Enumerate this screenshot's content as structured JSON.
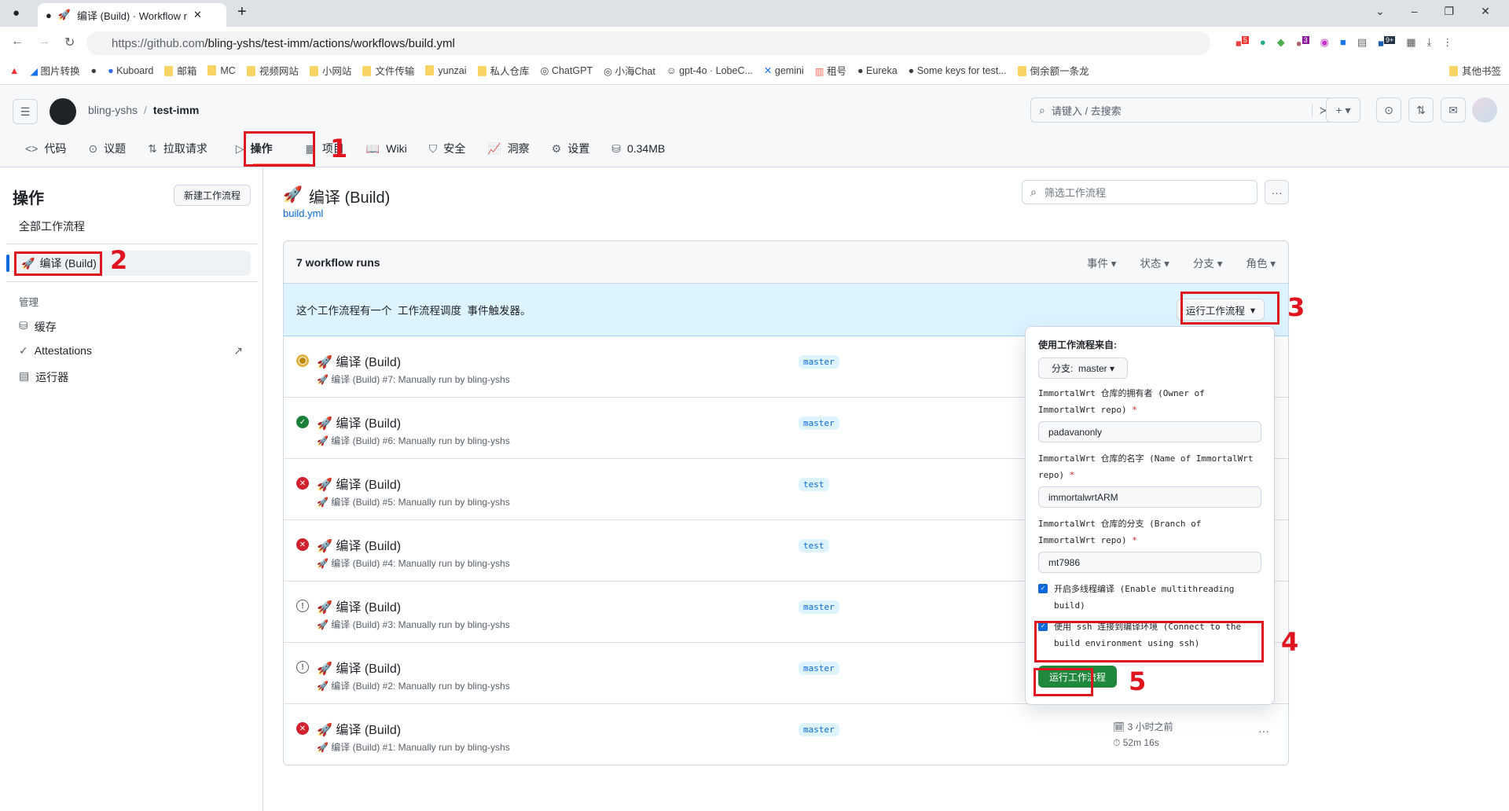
{
  "browser": {
    "tab_title": "编译 (Build) · Workflow run",
    "url_host": "https://github.com",
    "url_path": "/bling-yshs/test-imm/actions/workflows/build.yml",
    "bookmarks": [
      "图片转换",
      "",
      "Kuboard",
      "邮箱",
      "MC",
      "视频网站",
      "小网站",
      "文件传输",
      "yunzai",
      "私人仓库",
      "ChatGPT",
      "小海Chat",
      "gpt-4o · LobeC...",
      "gemini",
      "租号",
      "Eureka",
      "Some keys for test...",
      "倒余额一条龙"
    ],
    "other_bookmarks": "其他书签",
    "ext_badges": [
      "5",
      "3",
      "9+"
    ]
  },
  "header": {
    "owner": "bling-yshs",
    "sep": "/",
    "repo": "test-imm",
    "search_placeholder": "请键入 / 去搜索"
  },
  "nav": [
    {
      "icon": "code-icon",
      "label": "代码"
    },
    {
      "icon": "issue-icon",
      "label": "议题"
    },
    {
      "icon": "pull-request-icon",
      "label": "拉取请求"
    },
    {
      "icon": "play-icon",
      "label": "操作"
    },
    {
      "icon": "project-icon",
      "label": "项目"
    },
    {
      "icon": "book-icon",
      "label": "Wiki"
    },
    {
      "icon": "shield-icon",
      "label": "安全"
    },
    {
      "icon": "graph-icon",
      "label": "洞察"
    },
    {
      "icon": "gear-icon",
      "label": "设置"
    },
    {
      "icon": "database-icon",
      "label": "0.34MB"
    }
  ],
  "sidebar": {
    "title": "操作",
    "new_workflow": "新建工作流程",
    "all_workflows": "全部工作流程",
    "selected": "编译 (Build)",
    "manage": "管理",
    "items": [
      "缓存",
      "Attestations",
      "运行器"
    ]
  },
  "main": {
    "title": "编译 (Build)",
    "file": "build.yml",
    "filter_placeholder": "筛选工作流程",
    "runs_count": "7 workflow runs",
    "filters": [
      "事件",
      "状态",
      "分支",
      "角色"
    ],
    "banner": "这个工作流程有一个  工作流程调度  事件触发器。",
    "run_workflow": "运行工作流程",
    "runs": [
      {
        "status": "in_progress",
        "title": "编译 (Build)",
        "sub": "编译 (Build) #7: Manually run by bling-yshs",
        "branch": "master"
      },
      {
        "status": "success",
        "title": "编译 (Build)",
        "sub": "编译 (Build) #6: Manually run by bling-yshs",
        "branch": "master"
      },
      {
        "status": "failure",
        "title": "编译 (Build)",
        "sub": "编译 (Build) #5: Manually run by bling-yshs",
        "branch": "test"
      },
      {
        "status": "failure",
        "title": "编译 (Build)",
        "sub": "编译 (Build) #4: Manually run by bling-yshs",
        "branch": "test"
      },
      {
        "status": "cancelled",
        "title": "编译 (Build)",
        "sub": "编译 (Build) #3: Manually run by bling-yshs",
        "branch": "master"
      },
      {
        "status": "cancelled",
        "title": "编译 (Build)",
        "sub": "编译 (Build) #2: Manually run by bling-yshs",
        "branch": "master"
      },
      {
        "status": "failure",
        "title": "编译 (Build)",
        "sub": "编译 (Build) #1: Manually run by bling-yshs",
        "branch": "master",
        "time": "3 小时之前",
        "duration": "52m 16s"
      }
    ]
  },
  "dropdown": {
    "use_from": "使用工作流程来自:",
    "branch_label": "分支:",
    "branch": "master",
    "owner_label": "ImmortalWrt 仓库的拥有者 (Owner of ImmortalWrt repo)",
    "owner_value": "padavanonly",
    "name_label": "ImmortalWrt 仓库的名字 (Name of ImmortalWrt repo)",
    "name_value": "immortalwrtARM",
    "branch_field_label": "ImmortalWrt 仓库的分支 (Branch of ImmortalWrt repo)",
    "branch_value": "mt7986",
    "multithread": "开启多线程编译 (Enable multithreading build)",
    "multithread_checked": true,
    "ssh": "使用 ssh 连接到编译环境 (Connect to the build environment using ssh)",
    "ssh_checked": true,
    "submit": "运行工作流程"
  },
  "annotations": [
    "1",
    "2",
    "3",
    "4",
    "5"
  ],
  "colors": {
    "accent": "#0969da",
    "success": "#1a7f37",
    "failure": "#cf222e",
    "pending": "#bf8700",
    "annotation": "#e0141e",
    "primary_button": "#1f883d"
  }
}
